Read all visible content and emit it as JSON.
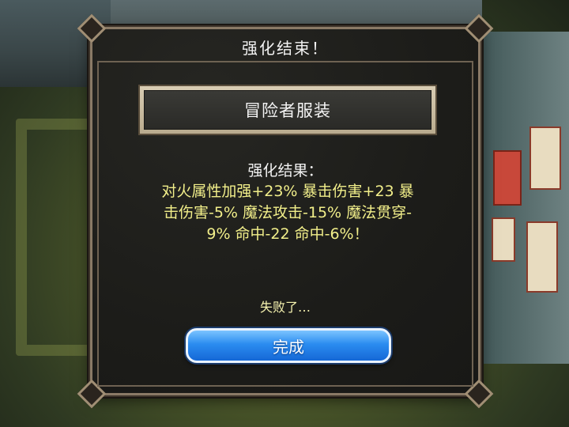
{
  "dialog": {
    "title": "强化结束！",
    "item_name": "冒险者服装",
    "result_label": "强化结果：",
    "result_lines": "对火属性加强+23% 暴击伤害+23 暴\n击伤害-5% 魔法攻击-15% 魔法贯穿-\n9% 命中-22 命中-6%！",
    "fail_text": "失败了…",
    "done_button": "完成"
  },
  "colors": {
    "result_text": "#f2ef8a",
    "button": "#2b8cf0",
    "frame": "#8a7a66"
  }
}
